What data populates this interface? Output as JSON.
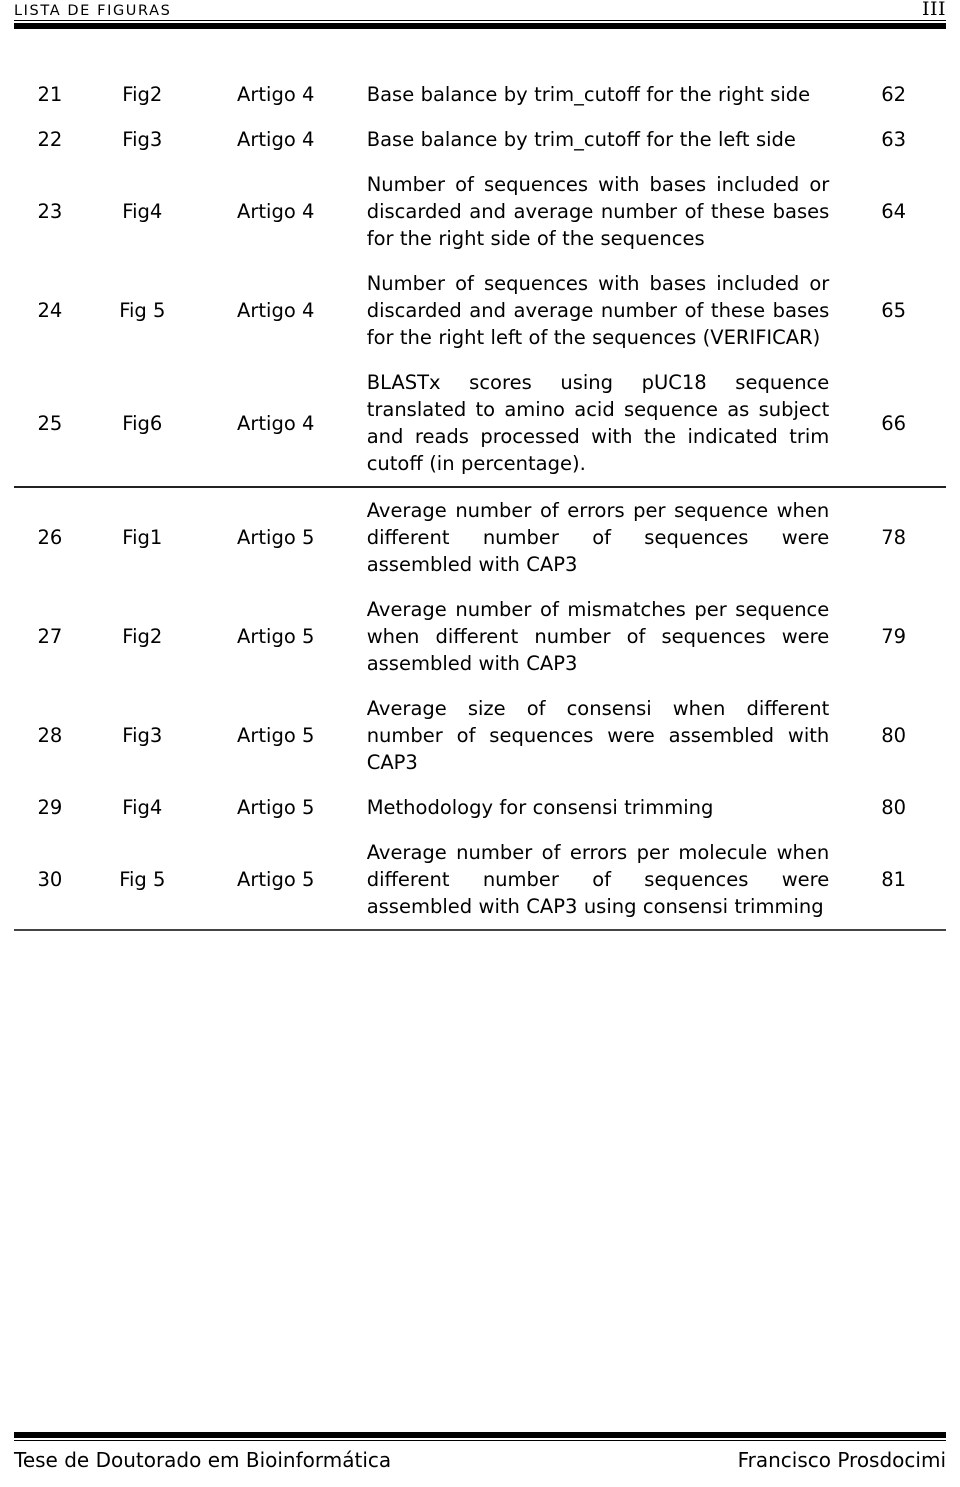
{
  "header": {
    "running_title": "Lista de Figuras",
    "folio": "III"
  },
  "table": {
    "rows": [
      {
        "num": "21",
        "figure": "Fig2",
        "source": "Artigo 4",
        "description": "Base balance by trim_cutoff for the right side",
        "page": "62",
        "group_end": false
      },
      {
        "num": "22",
        "figure": "Fig3",
        "source": "Artigo 4",
        "description": "Base balance by trim_cutoff for the left side",
        "page": "63",
        "group_end": false
      },
      {
        "num": "23",
        "figure": "Fig4",
        "source": "Artigo 4",
        "description": "Number of sequences with bases included or discarded and average number of these bases for the right side of the sequences",
        "page": "64",
        "group_end": false
      },
      {
        "num": "24",
        "figure": "Fig 5",
        "source": "Artigo 4",
        "description": "Number of sequences with bases included or discarded and average number of these bases for the right left of the sequences (VERIFICAR)",
        "page": "65",
        "group_end": false
      },
      {
        "num": "25",
        "figure": "Fig6",
        "source": "Artigo 4",
        "description": "BLASTx scores using pUC18 sequence translated to amino acid sequence as subject and reads processed with the indicated trim cutoff (in percentage).",
        "page": "66",
        "group_end": true
      },
      {
        "num": "26",
        "figure": "Fig1",
        "source": "Artigo 5",
        "description": "Average number of errors per sequence when different number of sequences were assembled with CAP3",
        "page": "78",
        "group_end": false
      },
      {
        "num": "27",
        "figure": "Fig2",
        "source": "Artigo 5",
        "description": "Average number of mismatches per sequence when different number of sequences were assembled with CAP3",
        "page": "79",
        "group_end": false
      },
      {
        "num": "28",
        "figure": "Fig3",
        "source": "Artigo 5",
        "description": "Average size of consensi when different number of sequences were assembled with CAP3",
        "page": "80",
        "group_end": false
      },
      {
        "num": "29",
        "figure": "Fig4",
        "source": "Artigo 5",
        "description": "Methodology for consensi trimming",
        "page": "80",
        "group_end": false
      },
      {
        "num": "30",
        "figure": "Fig 5",
        "source": "Artigo 5",
        "description": "Average number of errors per molecule when different number of sequences were assembled with CAP3 using consensi trimming",
        "page": "81",
        "group_end": false
      }
    ]
  },
  "footer": {
    "left": "Tese de Doutorado em Bioinformática",
    "right": "Francisco Prosdocimi"
  }
}
